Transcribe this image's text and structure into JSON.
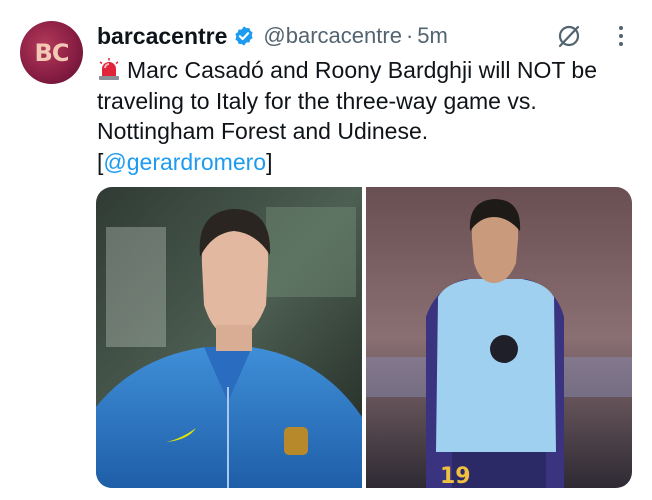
{
  "avatar": {
    "initials": "BC"
  },
  "tweet": {
    "author_name": "barcacentre",
    "author_handle": "@barcacentre",
    "separator": "·",
    "time": "5m",
    "text_main": "Marc Casadó and Roony Bardghji will NOT be traveling to Italy for the three-way game vs. Nottingham Forest and Udinese.",
    "mention_open": "[",
    "mention": "@gerardromero",
    "mention_close": "]"
  },
  "icons": {
    "siren": "siren-icon",
    "verified": "verified-badge-icon",
    "grok": "grok-icon",
    "more": "more-icon"
  },
  "colors": {
    "text": "#0f1419",
    "secondary": "#536471",
    "link": "#1d9bf0",
    "verified": "#1d9bf0"
  },
  "media": {
    "images": [
      {
        "name": "Marc Casadó"
      },
      {
        "name": "Roony Bardghji"
      }
    ]
  }
}
